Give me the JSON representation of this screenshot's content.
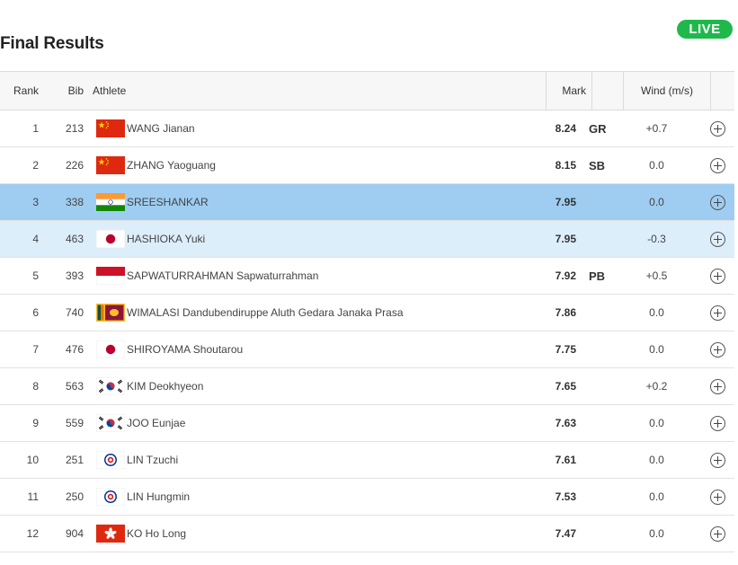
{
  "page": {
    "title": "Final Results",
    "live_label": "LIVE"
  },
  "table": {
    "headers": {
      "rank": "Rank",
      "bib": "Bib",
      "athlete": "Athlete",
      "mark": "Mark",
      "wind": "Wind (m/s)"
    },
    "rows": [
      {
        "rank": "1",
        "bib": "213",
        "flag": "CHN",
        "athlete": "WANG Jianan",
        "mark": "8.24",
        "note": "GR",
        "wind": "+0.7"
      },
      {
        "rank": "2",
        "bib": "226",
        "flag": "CHN",
        "athlete": "ZHANG Yaoguang",
        "mark": "8.15",
        "note": "SB",
        "wind": "0.0"
      },
      {
        "rank": "3",
        "bib": "338",
        "flag": "IND",
        "athlete": "SREESHANKAR",
        "mark": "7.95",
        "note": "",
        "wind": "0.0"
      },
      {
        "rank": "4",
        "bib": "463",
        "flag": "JPN",
        "athlete": "HASHIOKA Yuki",
        "mark": "7.95",
        "note": "",
        "wind": "-0.3"
      },
      {
        "rank": "5",
        "bib": "393",
        "flag": "INA",
        "athlete": "SAPWATURRAHMAN Sapwaturrahman",
        "mark": "7.92",
        "note": "PB",
        "wind": "+0.5"
      },
      {
        "rank": "6",
        "bib": "740",
        "flag": "SRI",
        "athlete": "WIMALASI Dandubendiruppe Aluth Gedara Janaka Prasa",
        "mark": "7.86",
        "note": "",
        "wind": "0.0"
      },
      {
        "rank": "7",
        "bib": "476",
        "flag": "JPN",
        "athlete": "SHIROYAMA Shoutarou",
        "mark": "7.75",
        "note": "",
        "wind": "0.0"
      },
      {
        "rank": "8",
        "bib": "563",
        "flag": "KOR",
        "athlete": "KIM Deokhyeon",
        "mark": "7.65",
        "note": "",
        "wind": "+0.2"
      },
      {
        "rank": "9",
        "bib": "559",
        "flag": "KOR",
        "athlete": "JOO Eunjae",
        "mark": "7.63",
        "note": "",
        "wind": "0.0"
      },
      {
        "rank": "10",
        "bib": "251",
        "flag": "TPE",
        "athlete": "LIN Tzuchi",
        "mark": "7.61",
        "note": "",
        "wind": "0.0"
      },
      {
        "rank": "11",
        "bib": "250",
        "flag": "TPE",
        "athlete": "LIN Hungmin",
        "mark": "7.53",
        "note": "",
        "wind": "0.0"
      },
      {
        "rank": "12",
        "bib": "904",
        "flag": "HKG",
        "athlete": "KO Ho Long",
        "mark": "7.47",
        "note": "",
        "wind": "0.0"
      }
    ]
  },
  "colors": {
    "live": "#1fb94b",
    "selected_row": "#9fcdf1",
    "hover_row": "#ddeefb"
  }
}
